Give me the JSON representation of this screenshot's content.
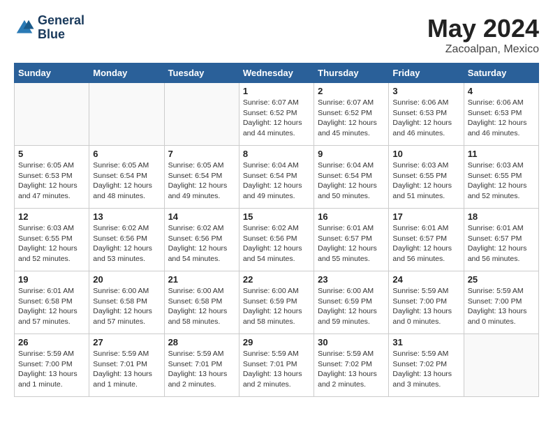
{
  "header": {
    "logo_line1": "General",
    "logo_line2": "Blue",
    "month": "May 2024",
    "location": "Zacoalpan, Mexico"
  },
  "days_of_week": [
    "Sunday",
    "Monday",
    "Tuesday",
    "Wednesday",
    "Thursday",
    "Friday",
    "Saturday"
  ],
  "weeks": [
    [
      {
        "day": "",
        "info": ""
      },
      {
        "day": "",
        "info": ""
      },
      {
        "day": "",
        "info": ""
      },
      {
        "day": "1",
        "info": "Sunrise: 6:07 AM\nSunset: 6:52 PM\nDaylight: 12 hours\nand 44 minutes."
      },
      {
        "day": "2",
        "info": "Sunrise: 6:07 AM\nSunset: 6:52 PM\nDaylight: 12 hours\nand 45 minutes."
      },
      {
        "day": "3",
        "info": "Sunrise: 6:06 AM\nSunset: 6:53 PM\nDaylight: 12 hours\nand 46 minutes."
      },
      {
        "day": "4",
        "info": "Sunrise: 6:06 AM\nSunset: 6:53 PM\nDaylight: 12 hours\nand 46 minutes."
      }
    ],
    [
      {
        "day": "5",
        "info": "Sunrise: 6:05 AM\nSunset: 6:53 PM\nDaylight: 12 hours\nand 47 minutes."
      },
      {
        "day": "6",
        "info": "Sunrise: 6:05 AM\nSunset: 6:54 PM\nDaylight: 12 hours\nand 48 minutes."
      },
      {
        "day": "7",
        "info": "Sunrise: 6:05 AM\nSunset: 6:54 PM\nDaylight: 12 hours\nand 49 minutes."
      },
      {
        "day": "8",
        "info": "Sunrise: 6:04 AM\nSunset: 6:54 PM\nDaylight: 12 hours\nand 49 minutes."
      },
      {
        "day": "9",
        "info": "Sunrise: 6:04 AM\nSunset: 6:54 PM\nDaylight: 12 hours\nand 50 minutes."
      },
      {
        "day": "10",
        "info": "Sunrise: 6:03 AM\nSunset: 6:55 PM\nDaylight: 12 hours\nand 51 minutes."
      },
      {
        "day": "11",
        "info": "Sunrise: 6:03 AM\nSunset: 6:55 PM\nDaylight: 12 hours\nand 52 minutes."
      }
    ],
    [
      {
        "day": "12",
        "info": "Sunrise: 6:03 AM\nSunset: 6:55 PM\nDaylight: 12 hours\nand 52 minutes."
      },
      {
        "day": "13",
        "info": "Sunrise: 6:02 AM\nSunset: 6:56 PM\nDaylight: 12 hours\nand 53 minutes."
      },
      {
        "day": "14",
        "info": "Sunrise: 6:02 AM\nSunset: 6:56 PM\nDaylight: 12 hours\nand 54 minutes."
      },
      {
        "day": "15",
        "info": "Sunrise: 6:02 AM\nSunset: 6:56 PM\nDaylight: 12 hours\nand 54 minutes."
      },
      {
        "day": "16",
        "info": "Sunrise: 6:01 AM\nSunset: 6:57 PM\nDaylight: 12 hours\nand 55 minutes."
      },
      {
        "day": "17",
        "info": "Sunrise: 6:01 AM\nSunset: 6:57 PM\nDaylight: 12 hours\nand 56 minutes."
      },
      {
        "day": "18",
        "info": "Sunrise: 6:01 AM\nSunset: 6:57 PM\nDaylight: 12 hours\nand 56 minutes."
      }
    ],
    [
      {
        "day": "19",
        "info": "Sunrise: 6:01 AM\nSunset: 6:58 PM\nDaylight: 12 hours\nand 57 minutes."
      },
      {
        "day": "20",
        "info": "Sunrise: 6:00 AM\nSunset: 6:58 PM\nDaylight: 12 hours\nand 57 minutes."
      },
      {
        "day": "21",
        "info": "Sunrise: 6:00 AM\nSunset: 6:58 PM\nDaylight: 12 hours\nand 58 minutes."
      },
      {
        "day": "22",
        "info": "Sunrise: 6:00 AM\nSunset: 6:59 PM\nDaylight: 12 hours\nand 58 minutes."
      },
      {
        "day": "23",
        "info": "Sunrise: 6:00 AM\nSunset: 6:59 PM\nDaylight: 12 hours\nand 59 minutes."
      },
      {
        "day": "24",
        "info": "Sunrise: 5:59 AM\nSunset: 7:00 PM\nDaylight: 13 hours\nand 0 minutes."
      },
      {
        "day": "25",
        "info": "Sunrise: 5:59 AM\nSunset: 7:00 PM\nDaylight: 13 hours\nand 0 minutes."
      }
    ],
    [
      {
        "day": "26",
        "info": "Sunrise: 5:59 AM\nSunset: 7:00 PM\nDaylight: 13 hours\nand 1 minute."
      },
      {
        "day": "27",
        "info": "Sunrise: 5:59 AM\nSunset: 7:01 PM\nDaylight: 13 hours\nand 1 minute."
      },
      {
        "day": "28",
        "info": "Sunrise: 5:59 AM\nSunset: 7:01 PM\nDaylight: 13 hours\nand 2 minutes."
      },
      {
        "day": "29",
        "info": "Sunrise: 5:59 AM\nSunset: 7:01 PM\nDaylight: 13 hours\nand 2 minutes."
      },
      {
        "day": "30",
        "info": "Sunrise: 5:59 AM\nSunset: 7:02 PM\nDaylight: 13 hours\nand 2 minutes."
      },
      {
        "day": "31",
        "info": "Sunrise: 5:59 AM\nSunset: 7:02 PM\nDaylight: 13 hours\nand 3 minutes."
      },
      {
        "day": "",
        "info": ""
      }
    ]
  ]
}
